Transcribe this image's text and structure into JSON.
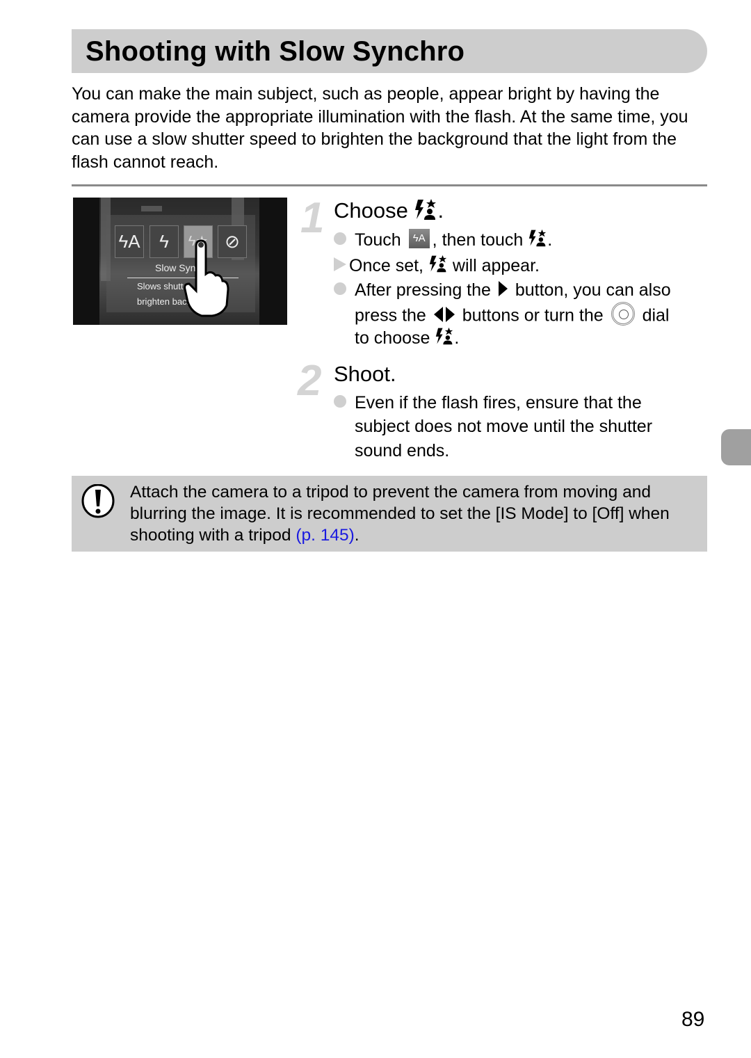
{
  "page": {
    "title": "Shooting with Slow Synchro",
    "intro": "You can make the main subject, such as people, appear bright by having the camera provide the appropriate illumination with the flash. At the same time, you can use a slow shutter speed to brighten the background that the light from the flash cannot reach.",
    "page_number": "89"
  },
  "screen": {
    "modes": [
      {
        "icon": "flash-auto-icon",
        "glyph": "ϟA"
      },
      {
        "icon": "flash-on-icon",
        "glyph": "ϟ"
      },
      {
        "icon": "slow-synchro-icon",
        "glyph": "ϟ★",
        "selected": true
      },
      {
        "icon": "flash-off-icon",
        "glyph": "⊘"
      }
    ],
    "label": "Slow Sync",
    "desc_line1": "Slows shutte",
    "desc_line2": "brighten back"
  },
  "steps": [
    {
      "number": "1",
      "title": "Choose",
      "title_end": ".",
      "lines": {
        "l1_a": "Touch",
        "l1_b": ", then touch",
        "l1_c": ".",
        "l2_a": "Once set,",
        "l2_b": "will appear.",
        "l3_a": "After pressing the",
        "l3_b": "button, you can also",
        "l4_a": "press the",
        "l4_b": "buttons or turn the",
        "l4_c": "dial",
        "l5_a": "to choose",
        "l5_b": "."
      },
      "auto_icon_label": "ϟA"
    },
    {
      "number": "2",
      "title": "Shoot.",
      "lines": [
        "Even if the flash fires, ensure that the",
        "subject does not move until the shutter",
        "sound ends."
      ]
    }
  ],
  "note": {
    "icon": "caution-icon",
    "text": "Attach the camera to a tripod to prevent the camera from moving and blurring the image. It is recommended to set the [IS Mode] to [Off] when shooting with a tripod ",
    "link": "(p. 145)",
    "text_end": "."
  },
  "colors": {
    "title_bar": "#cdcdcd",
    "note_bg": "#cdcdcd",
    "link": "#1a1ae0",
    "step_number": "#d4d4d4",
    "side_tab": "#a0a0a0"
  }
}
